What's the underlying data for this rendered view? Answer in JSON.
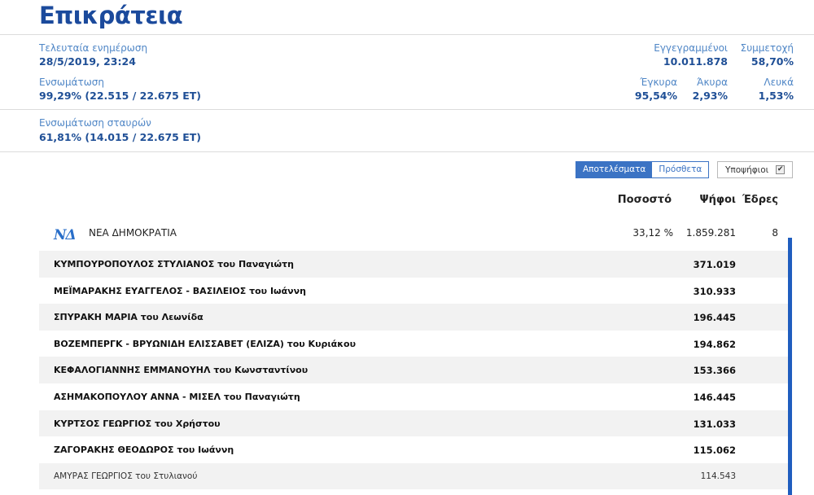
{
  "header": {
    "title": "Επικράτεια"
  },
  "summary": {
    "last_update_label": "Τελευταία ενημέρωση",
    "last_update_value": "28/5/2019, 23:24",
    "integration_label": "Ενσωμάτωση",
    "integration_value": "99,29% (22.515 / 22.675 ΕΤ)",
    "cross_integration_label": "Ενσωμάτωση σταυρών",
    "cross_integration_value": "61,81% (14.015 / 22.675 ΕΤ)",
    "registered_label": "Εγγεγραμμένοι",
    "registered_value": "10.011.878",
    "turnout_label": "Συμμετοχή",
    "turnout_value": "58,70%",
    "valid_label": "Έγκυρα",
    "valid_value": "95,54%",
    "invalid_label": "Άκυρα",
    "invalid_value": "2,93%",
    "blank_label": "Λευκά",
    "blank_value": "1,53%"
  },
  "controls": {
    "results_tab": "Αποτελέσματα",
    "extra_tab": "Πρόσθετα",
    "candidates_label": "Υποψήφιοι",
    "candidates_checked": true
  },
  "table": {
    "col_percent": "Ποσοστό",
    "col_votes": "Ψήφοι",
    "col_seats": "Έδρες"
  },
  "party": {
    "logo_icon": "nd-party-logo",
    "name": "ΝΕΑ ΔΗΜΟΚΡΑΤΙΑ",
    "percent": "33,12 %",
    "votes": "1.859.281",
    "seats": "8",
    "accent_color": "#1f5dbf"
  },
  "candidates": [
    {
      "name": "ΚΥΜΠΟΥΡΟΠΟΥΛΟΣ ΣΤΥΛΙΑΝΟΣ του Παναγιώτη",
      "votes": "371.019"
    },
    {
      "name": "ΜΕΪΜΑΡΑΚΗΣ ΕΥΑΓΓΕΛΟΣ - ΒΑΣΙΛΕΙΟΣ του Ιωάννη",
      "votes": "310.933"
    },
    {
      "name": "ΣΠΥΡΑΚΗ ΜΑΡΙΑ του Λεωνίδα",
      "votes": "196.445"
    },
    {
      "name": "ΒΟΖΕΜΠΕΡΓΚ - ΒΡΥΩΝΙΔΗ ΕΛΙΣΣΑΒΕΤ (ΕΛΙΖΑ) του Κυριάκου",
      "votes": "194.862"
    },
    {
      "name": "ΚΕΦΑΛΟΓΙΑΝΝΗΣ ΕΜΜΑΝΟΥΗΛ του Κωνσταντίνου",
      "votes": "153.366"
    },
    {
      "name": "ΑΣΗΜΑΚΟΠΟΥΛΟΥ ΑΝΝΑ - ΜΙΣΕΛ του Παναγιώτη",
      "votes": "146.445"
    },
    {
      "name": "ΚΥΡΤΣΟΣ ΓΕΩΡΓΙΟΣ του Χρήστου",
      "votes": "131.033"
    },
    {
      "name": "ΖΑΓΟΡΑΚΗΣ ΘΕΟΔΩΡΟΣ του Ιωάννη",
      "votes": "115.062"
    },
    {
      "name": "ΑΜΥΡΑΣ ΓΕΩΡΓΙΟΣ του Στυλιανού",
      "votes": "114.543"
    }
  ]
}
